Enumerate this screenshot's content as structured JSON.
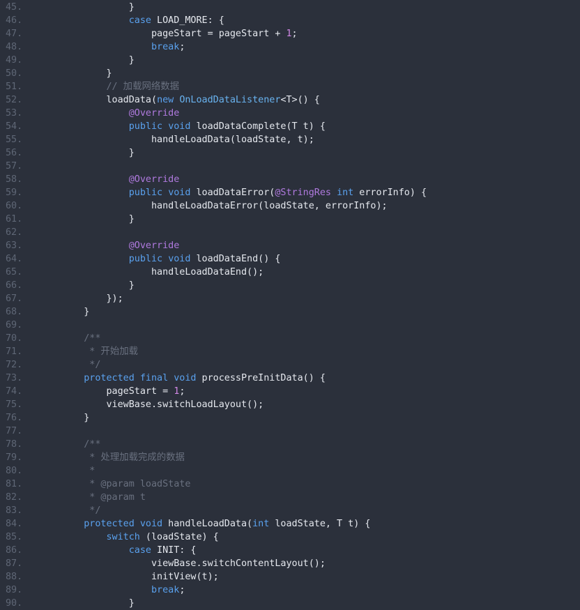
{
  "editor": {
    "theme": {
      "background": "#2b303b",
      "line_number": "#5f6776",
      "text": "#e5e8ee",
      "keyword": "#5aa1ee",
      "class": "#69b3f0",
      "annotation": "#b07adf",
      "number": "#d188e6",
      "comment": "#69707f"
    },
    "lines": [
      {
        "n": "45.",
        "tokens": [
          {
            "t": "txt",
            "v": "            }"
          }
        ]
      },
      {
        "n": "46.",
        "tokens": [
          {
            "t": "txt",
            "v": "            "
          },
          {
            "t": "kw",
            "v": "case"
          },
          {
            "t": "txt",
            "v": " LOAD_MORE: {"
          }
        ]
      },
      {
        "n": "47.",
        "tokens": [
          {
            "t": "txt",
            "v": "                pageStart = pageStart + "
          },
          {
            "t": "num",
            "v": "1"
          },
          {
            "t": "txt",
            "v": ";"
          }
        ]
      },
      {
        "n": "48.",
        "tokens": [
          {
            "t": "txt",
            "v": "                "
          },
          {
            "t": "kw",
            "v": "break"
          },
          {
            "t": "txt",
            "v": ";"
          }
        ]
      },
      {
        "n": "49.",
        "tokens": [
          {
            "t": "txt",
            "v": "            }"
          }
        ]
      },
      {
        "n": "50.",
        "tokens": [
          {
            "t": "txt",
            "v": "        }"
          }
        ]
      },
      {
        "n": "51.",
        "tokens": [
          {
            "t": "com",
            "v": "        // 加载网络数据"
          }
        ]
      },
      {
        "n": "52.",
        "tokens": [
          {
            "t": "txt",
            "v": "        loadData("
          },
          {
            "t": "kw",
            "v": "new"
          },
          {
            "t": "txt",
            "v": " "
          },
          {
            "t": "cls",
            "v": "OnLoadDataListener"
          },
          {
            "t": "txt",
            "v": "<T>() {"
          }
        ]
      },
      {
        "n": "53.",
        "tokens": [
          {
            "t": "txt",
            "v": "            "
          },
          {
            "t": "ann",
            "v": "@Override"
          }
        ]
      },
      {
        "n": "54.",
        "tokens": [
          {
            "t": "txt",
            "v": "            "
          },
          {
            "t": "kw",
            "v": "public"
          },
          {
            "t": "txt",
            "v": " "
          },
          {
            "t": "kw",
            "v": "void"
          },
          {
            "t": "txt",
            "v": " loadDataComplete(T t) {"
          }
        ]
      },
      {
        "n": "55.",
        "tokens": [
          {
            "t": "txt",
            "v": "                handleLoadData(loadState, t);"
          }
        ]
      },
      {
        "n": "56.",
        "tokens": [
          {
            "t": "txt",
            "v": "            }"
          }
        ]
      },
      {
        "n": "57.",
        "tokens": [
          {
            "t": "txt",
            "v": ""
          }
        ]
      },
      {
        "n": "58.",
        "tokens": [
          {
            "t": "txt",
            "v": "            "
          },
          {
            "t": "ann",
            "v": "@Override"
          }
        ]
      },
      {
        "n": "59.",
        "tokens": [
          {
            "t": "txt",
            "v": "            "
          },
          {
            "t": "kw",
            "v": "public"
          },
          {
            "t": "txt",
            "v": " "
          },
          {
            "t": "kw",
            "v": "void"
          },
          {
            "t": "txt",
            "v": " loadDataError("
          },
          {
            "t": "ann",
            "v": "@StringRes"
          },
          {
            "t": "txt",
            "v": " "
          },
          {
            "t": "kw",
            "v": "int"
          },
          {
            "t": "txt",
            "v": " errorInfo) {"
          }
        ]
      },
      {
        "n": "60.",
        "tokens": [
          {
            "t": "txt",
            "v": "                handleLoadDataError(loadState, errorInfo);"
          }
        ]
      },
      {
        "n": "61.",
        "tokens": [
          {
            "t": "txt",
            "v": "            }"
          }
        ]
      },
      {
        "n": "62.",
        "tokens": [
          {
            "t": "txt",
            "v": ""
          }
        ]
      },
      {
        "n": "63.",
        "tokens": [
          {
            "t": "txt",
            "v": "            "
          },
          {
            "t": "ann",
            "v": "@Override"
          }
        ]
      },
      {
        "n": "64.",
        "tokens": [
          {
            "t": "txt",
            "v": "            "
          },
          {
            "t": "kw",
            "v": "public"
          },
          {
            "t": "txt",
            "v": " "
          },
          {
            "t": "kw",
            "v": "void"
          },
          {
            "t": "txt",
            "v": " loadDataEnd() {"
          }
        ]
      },
      {
        "n": "65.",
        "tokens": [
          {
            "t": "txt",
            "v": "                handleLoadDataEnd();"
          }
        ]
      },
      {
        "n": "66.",
        "tokens": [
          {
            "t": "txt",
            "v": "            }"
          }
        ]
      },
      {
        "n": "67.",
        "tokens": [
          {
            "t": "txt",
            "v": "        });"
          }
        ]
      },
      {
        "n": "68.",
        "tokens": [
          {
            "t": "txt",
            "v": "    }"
          }
        ]
      },
      {
        "n": "69.",
        "tokens": [
          {
            "t": "txt",
            "v": ""
          }
        ]
      },
      {
        "n": "70.",
        "tokens": [
          {
            "t": "com",
            "v": "    /**"
          }
        ]
      },
      {
        "n": "71.",
        "tokens": [
          {
            "t": "com",
            "v": "     * 开始加载"
          }
        ]
      },
      {
        "n": "72.",
        "tokens": [
          {
            "t": "com",
            "v": "     */"
          }
        ]
      },
      {
        "n": "73.",
        "tokens": [
          {
            "t": "txt",
            "v": "    "
          },
          {
            "t": "kw",
            "v": "protected"
          },
          {
            "t": "txt",
            "v": " "
          },
          {
            "t": "kw",
            "v": "final"
          },
          {
            "t": "txt",
            "v": " "
          },
          {
            "t": "kw",
            "v": "void"
          },
          {
            "t": "txt",
            "v": " processPreInitData() {"
          }
        ]
      },
      {
        "n": "74.",
        "tokens": [
          {
            "t": "txt",
            "v": "        pageStart = "
          },
          {
            "t": "num",
            "v": "1"
          },
          {
            "t": "txt",
            "v": ";"
          }
        ]
      },
      {
        "n": "75.",
        "tokens": [
          {
            "t": "txt",
            "v": "        viewBase.switchLoadLayout();"
          }
        ]
      },
      {
        "n": "76.",
        "tokens": [
          {
            "t": "txt",
            "v": "    }"
          }
        ]
      },
      {
        "n": "77.",
        "tokens": [
          {
            "t": "txt",
            "v": ""
          }
        ]
      },
      {
        "n": "78.",
        "tokens": [
          {
            "t": "com",
            "v": "    /**"
          }
        ]
      },
      {
        "n": "79.",
        "tokens": [
          {
            "t": "com",
            "v": "     * 处理加载完成的数据"
          }
        ]
      },
      {
        "n": "80.",
        "tokens": [
          {
            "t": "com",
            "v": "     *"
          }
        ]
      },
      {
        "n": "81.",
        "tokens": [
          {
            "t": "com",
            "v": "     * @param loadState"
          }
        ]
      },
      {
        "n": "82.",
        "tokens": [
          {
            "t": "com",
            "v": "     * @param t"
          }
        ]
      },
      {
        "n": "83.",
        "tokens": [
          {
            "t": "com",
            "v": "     */"
          }
        ]
      },
      {
        "n": "84.",
        "tokens": [
          {
            "t": "txt",
            "v": "    "
          },
          {
            "t": "kw",
            "v": "protected"
          },
          {
            "t": "txt",
            "v": " "
          },
          {
            "t": "kw",
            "v": "void"
          },
          {
            "t": "txt",
            "v": " handleLoadData("
          },
          {
            "t": "kw",
            "v": "int"
          },
          {
            "t": "txt",
            "v": " loadState, T t) {"
          }
        ]
      },
      {
        "n": "85.",
        "tokens": [
          {
            "t": "txt",
            "v": "        "
          },
          {
            "t": "kw",
            "v": "switch"
          },
          {
            "t": "txt",
            "v": " (loadState) {"
          }
        ]
      },
      {
        "n": "86.",
        "tokens": [
          {
            "t": "txt",
            "v": "            "
          },
          {
            "t": "kw",
            "v": "case"
          },
          {
            "t": "txt",
            "v": " INIT: {"
          }
        ]
      },
      {
        "n": "87.",
        "tokens": [
          {
            "t": "txt",
            "v": "                viewBase.switchContentLayout();"
          }
        ]
      },
      {
        "n": "88.",
        "tokens": [
          {
            "t": "txt",
            "v": "                initView(t);"
          }
        ]
      },
      {
        "n": "89.",
        "tokens": [
          {
            "t": "txt",
            "v": "                "
          },
          {
            "t": "kw",
            "v": "break"
          },
          {
            "t": "txt",
            "v": ";"
          }
        ]
      },
      {
        "n": "90.",
        "tokens": [
          {
            "t": "txt",
            "v": "            }"
          }
        ]
      }
    ]
  }
}
